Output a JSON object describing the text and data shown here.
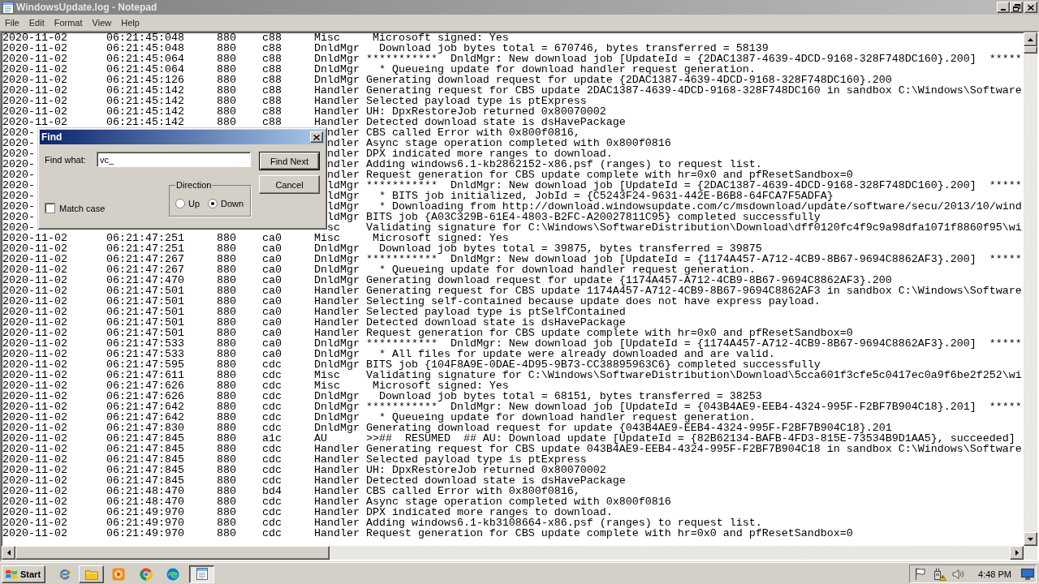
{
  "window": {
    "title": "WindowsUpdate.log - Notepad",
    "active": false
  },
  "menu": [
    "File",
    "Edit",
    "Format",
    "View",
    "Help"
  ],
  "lines": [
    {
      "kind": "full",
      "text": "2020-11-02\t06:21:45:048\t 880\tc88\tMisc\t Microsoft signed: Yes"
    },
    {
      "kind": "full",
      "text": "2020-11-02\t06:21:45:048\t 880\tc88\tDnldMgr\t  Download job bytes total = 670746, bytes transferred = 58139"
    },
    {
      "kind": "full",
      "text": "2020-11-02\t06:21:45:064\t 880\tc88\tDnldMgr\t***********  DnldMgr: New download job [UpdateId = {2DAC1387-4639-4DCD-9168-328F748DC160}.200]  *****"
    },
    {
      "kind": "full",
      "text": "2020-11-02\t06:21:45:064\t 880\tc88\tDnldMgr\t  * Queueing update for download handler request generation."
    },
    {
      "kind": "full",
      "text": "2020-11-02\t06:21:45:126\t 880\tc88\tDnldMgr\tGenerating download request for update {2DAC1387-4639-4DCD-9168-328F748DC160}.200"
    },
    {
      "kind": "full",
      "text": "2020-11-02\t06:21:45:142\t 880\tc88\tHandler\tGenerating request for CBS update 2DAC1387-4639-4DCD-9168-328F748DC160 in sandbox C:\\Windows\\Software"
    },
    {
      "kind": "full",
      "text": "2020-11-02\t06:21:45:142\t 880\tc88\tHandler\tSelected payload type is ptExpress"
    },
    {
      "kind": "full",
      "text": "2020-11-02\t06:21:45:142\t 880\tc88\tHandler\tUH: DpxRestoreJob returned 0x80070002"
    },
    {
      "kind": "full",
      "text": "2020-11-02\t06:21:45:142\t 880\tc88\tHandler\tDetected download state is dsHavePackage"
    },
    {
      "kind": "covered",
      "left": "2020-",
      "right": "ndler\tCBS called Error with 0x800f0816,"
    },
    {
      "kind": "covered",
      "left": "2020-",
      "right": "ndler\tAsync stage operation completed with 0x800f0816"
    },
    {
      "kind": "covered",
      "left": "2020-",
      "right": "ndler\tDPX indicated more ranges to download."
    },
    {
      "kind": "covered",
      "left": "2020-",
      "right": "ndler\tAdding windows6.1-kb2862152-x86.psf (ranges) to request list."
    },
    {
      "kind": "covered",
      "left": "2020-",
      "right": "ndler\tRequest generation for CBS update complete with hr=0x0 and pfResetSandbox=0"
    },
    {
      "kind": "covered",
      "left": "2020-",
      "right": "ldMgr\t***********  DnldMgr: New download job [UpdateId = {2DAC1387-4639-4DCD-9168-328F748DC160}.200]  *****"
    },
    {
      "kind": "covered",
      "left": "2020-",
      "right": "ldMgr\t  * BITS job initialized, JobId = {C5243F24-9631-442E-B6B8-64FCA7F5ADFA}"
    },
    {
      "kind": "covered",
      "left": "2020-",
      "right": "ldMgr\t  * Downloading from http://download.windowsupdate.com/c/msdownload/update/software/secu/2013/10/wind"
    },
    {
      "kind": "covered",
      "left": "2020-",
      "right": "ldMgr\tBITS job {A03C329B-61E4-4803-B2FC-A20027811C95} completed successfully"
    },
    {
      "kind": "covered",
      "left": "2020-",
      "right": "sc\tValidating signature for C:\\Windows\\SoftwareDistribution\\Download\\dff0120fc4f9c9a98dfa1071f8860f95\\wi"
    },
    {
      "kind": "full",
      "text": "2020-11-02\t06:21:47:251\t 880\tca0\tMisc\t Microsoft signed: Yes"
    },
    {
      "kind": "full",
      "text": "2020-11-02\t06:21:47:251\t 880\tca0\tDnldMgr\t  Download job bytes total = 39875, bytes transferred = 39875"
    },
    {
      "kind": "full",
      "text": "2020-11-02\t06:21:47:267\t 880\tca0\tDnldMgr\t***********  DnldMgr: New download job [UpdateId = {1174A457-A712-4CB9-8B67-9694C8862AF3}.200]  *****"
    },
    {
      "kind": "full",
      "text": "2020-11-02\t06:21:47:267\t 880\tca0\tDnldMgr\t  * Queueing update for download handler request generation."
    },
    {
      "kind": "full",
      "text": "2020-11-02\t06:21:47:470\t 880\tca0\tDnldMgr\tGenerating download request for update {1174A457-A712-4CB9-8B67-9694C8862AF3}.200"
    },
    {
      "kind": "full",
      "text": "2020-11-02\t06:21:47:501\t 880\tca0\tHandler\tGenerating request for CBS update 1174A457-A712-4CB9-8B67-9694C8862AF3 in sandbox C:\\Windows\\Software"
    },
    {
      "kind": "full",
      "text": "2020-11-02\t06:21:47:501\t 880\tca0\tHandler\tSelecting self-contained because update does not have express payload."
    },
    {
      "kind": "full",
      "text": "2020-11-02\t06:21:47:501\t 880\tca0\tHandler\tSelected payload type is ptSelfContained"
    },
    {
      "kind": "full",
      "text": "2020-11-02\t06:21:47:501\t 880\tca0\tHandler\tDetected download state is dsHavePackage"
    },
    {
      "kind": "full",
      "text": "2020-11-02\t06:21:47:501\t 880\tca0\tHandler\tRequest generation for CBS update complete with hr=0x0 and pfResetSandbox=0"
    },
    {
      "kind": "full",
      "text": "2020-11-02\t06:21:47:533\t 880\tca0\tDnldMgr\t***********  DnldMgr: New download job [UpdateId = {1174A457-A712-4CB9-8B67-9694C8862AF3}.200]  *****"
    },
    {
      "kind": "full",
      "text": "2020-11-02\t06:21:47:533\t 880\tca0\tDnldMgr\t  * All files for update were already downloaded and are valid."
    },
    {
      "kind": "full",
      "text": "2020-11-02\t06:21:47:595\t 880\tcdc\tDnldMgr\tBITS job {104F8A9E-0DAE-4D95-9B73-CC38895963C6} completed successfully"
    },
    {
      "kind": "full",
      "text": "2020-11-02\t06:21:47:611\t 880\tcdc\tMisc\tValidating signature for C:\\Windows\\SoftwareDistribution\\Download\\5cca601f3cfe5c0417ec0a9f6be2f252\\wi"
    },
    {
      "kind": "full",
      "text": "2020-11-02\t06:21:47:626\t 880\tcdc\tMisc\t Microsoft signed: Yes"
    },
    {
      "kind": "full",
      "text": "2020-11-02\t06:21:47:626\t 880\tcdc\tDnldMgr\t  Download job bytes total = 68151, bytes transferred = 38253"
    },
    {
      "kind": "full",
      "text": "2020-11-02\t06:21:47:642\t 880\tcdc\tDnldMgr\t***********  DnldMgr: New download job [UpdateId = {043B4AE9-EEB4-4324-995F-F2BF7B904C18}.201]  *****"
    },
    {
      "kind": "full",
      "text": "2020-11-02\t06:21:47:642\t 880\tcdc\tDnldMgr\t  * Queueing update for download handler request generation."
    },
    {
      "kind": "full",
      "text": "2020-11-02\t06:21:47:830\t 880\tcdc\tDnldMgr\tGenerating download request for update {043B4AE9-EEB4-4324-995F-F2BF7B904C18}.201"
    },
    {
      "kind": "full",
      "text": "2020-11-02\t06:21:47:845\t 880\ta1c\tAU\t>>##  RESUMED  ## AU: Download update [UpdateId = {82B62134-BAFB-4FD3-815E-73534B9D1AA5}, succeeded]"
    },
    {
      "kind": "full",
      "text": "2020-11-02\t06:21:47:845\t 880\tcdc\tHandler\tGenerating request for CBS update 043B4AE9-EEB4-4324-995F-F2BF7B904C18 in sandbox C:\\Windows\\Software"
    },
    {
      "kind": "full",
      "text": "2020-11-02\t06:21:47:845\t 880\tcdc\tHandler\tSelected payload type is ptExpress"
    },
    {
      "kind": "full",
      "text": "2020-11-02\t06:21:47:845\t 880\tcdc\tHandler\tUH: DpxRestoreJob returned 0x80070002"
    },
    {
      "kind": "full",
      "text": "2020-11-02\t06:21:47:845\t 880\tcdc\tHandler\tDetected download state is dsHavePackage"
    },
    {
      "kind": "full",
      "text": "2020-11-02\t06:21:48:470\t 880\tbd4\tHandler\tCBS called Error with 0x800f0816,"
    },
    {
      "kind": "full",
      "text": "2020-11-02\t06:21:48:470\t 880\tcdc\tHandler\tAsync stage operation completed with 0x800f0816"
    },
    {
      "kind": "full",
      "text": "2020-11-02\t06:21:49:970\t 880\tcdc\tHandler\tDPX indicated more ranges to download."
    },
    {
      "kind": "full",
      "text": "2020-11-02\t06:21:49:970\t 880\tcdc\tHandler\tAdding windows6.1-kb3108664-x86.psf (ranges) to request list."
    },
    {
      "kind": "full",
      "text": "2020-11-02\t06:21:49:970\t 880\tcdc\tHandler\tRequest generation for CBS update complete with hr=0x0 and pfResetSandbox=0"
    }
  ],
  "find_dialog": {
    "title": "Find",
    "active": true,
    "find_what_label": "Find what:",
    "find_what_value": "vc_",
    "buttons": [
      {
        "label": "Find Next",
        "default": true
      },
      {
        "label": "Cancel",
        "default": false
      }
    ],
    "direction": {
      "label": "Direction",
      "options": [
        {
          "label": "Up",
          "selected": false
        },
        {
          "label": "Down",
          "selected": true
        }
      ]
    },
    "match_case": {
      "label": "Match case",
      "checked": false
    }
  },
  "taskbar": {
    "start_label": "Start",
    "clock": "4:48 PM"
  }
}
